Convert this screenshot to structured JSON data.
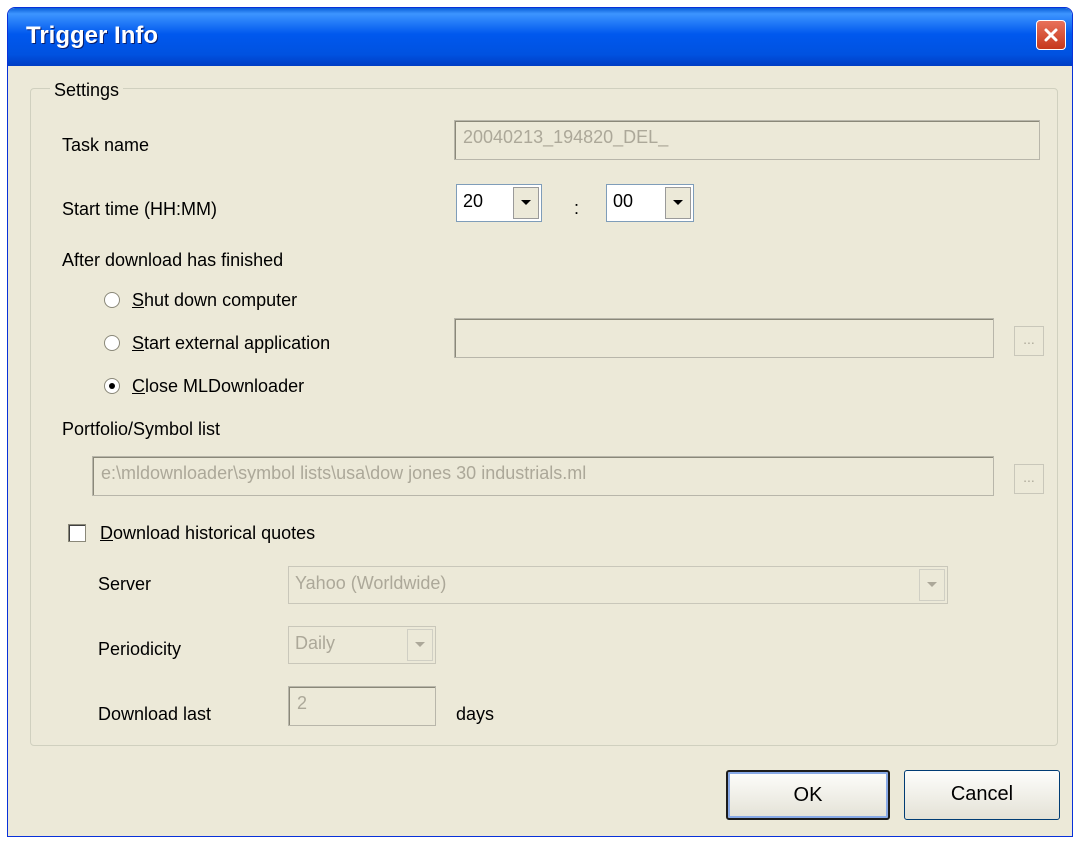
{
  "window": {
    "title": "Trigger Info"
  },
  "settings": {
    "legend": "Settings",
    "task_name_label": "Task name",
    "task_name_value": "20040213_194820_DEL_",
    "start_time_label": "Start time (HH:MM)",
    "hour_value": "20",
    "minute_value": "00",
    "time_separator": ":",
    "after_download_label": "After download has finished",
    "radio_shutdown": {
      "accel": "S",
      "rest": "hut down computer"
    },
    "radio_start_app": {
      "accel": "S",
      "rest": "tart external application"
    },
    "radio_close": {
      "accel": "C",
      "rest": "lose MLDownloader"
    },
    "selected_option": "close",
    "external_app_value": "",
    "browse_label": "...",
    "portfolio_label": "Portfolio/Symbol list",
    "portfolio_value": "e:\\mldownloader\\symbol lists\\usa\\dow jones 30 industrials.ml",
    "historical_check": {
      "accel": "D",
      "rest": "ownload historical quotes",
      "checked": false
    },
    "server_label": "Server",
    "server_value": "Yahoo (Worldwide)",
    "periodicity_label": "Periodicity",
    "periodicity_value": "Daily",
    "download_last_label": "Download last",
    "download_last_value": "2",
    "days_label": "days"
  },
  "buttons": {
    "ok": "OK",
    "cancel": "Cancel"
  },
  "colors": {
    "titlebar": "#0058ee",
    "dialog_bg": "#ece9d8",
    "disabled_text": "#aca899",
    "close": "#c6381c"
  }
}
